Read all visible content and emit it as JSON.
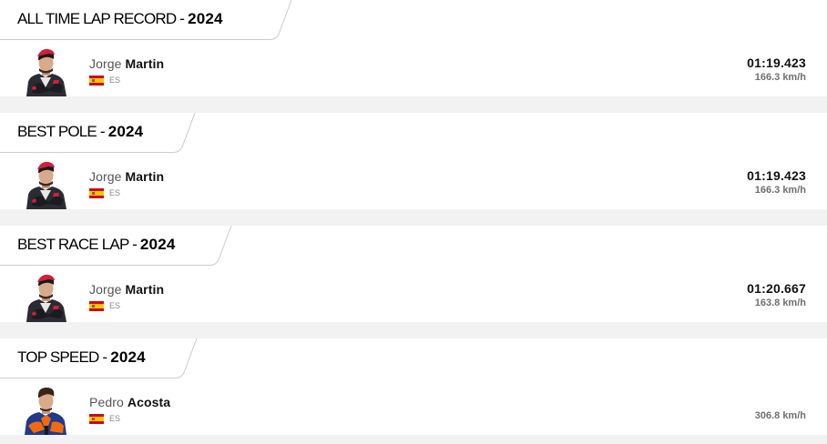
{
  "records": [
    {
      "title": "ALL TIME LAP RECORD - ",
      "year": "2024",
      "rider": {
        "first_name": "Jorge",
        "last_name": "Martin",
        "country_code": "ES",
        "flag": "spain-flag-icon"
      },
      "time": "01:19.423",
      "speed": "166.3 km/h"
    },
    {
      "title": "BEST POLE - ",
      "year": "2024",
      "rider": {
        "first_name": "Jorge",
        "last_name": "Martin",
        "country_code": "ES",
        "flag": "spain-flag-icon"
      },
      "time": "01:19.423",
      "speed": "166.3 km/h"
    },
    {
      "title": "BEST RACE LAP - ",
      "year": "2024",
      "rider": {
        "first_name": "Jorge",
        "last_name": "Martin",
        "country_code": "ES",
        "flag": "spain-flag-icon"
      },
      "time": "01:20.667",
      "speed": "163.8 km/h"
    },
    {
      "title": "TOP SPEED - ",
      "year": "2024",
      "rider": {
        "first_name": "Pedro",
        "last_name": "Acosta",
        "country_code": "ES",
        "flag": "spain-flag-icon"
      },
      "time": "",
      "speed": "306.8 km/h"
    }
  ],
  "colors": {
    "strip": "#f2f2f2",
    "tab_border": "#cccccc",
    "muted_text": "#6f6f6f",
    "flag_red": "#c60b1e",
    "flag_yellow": "#ffc400"
  }
}
